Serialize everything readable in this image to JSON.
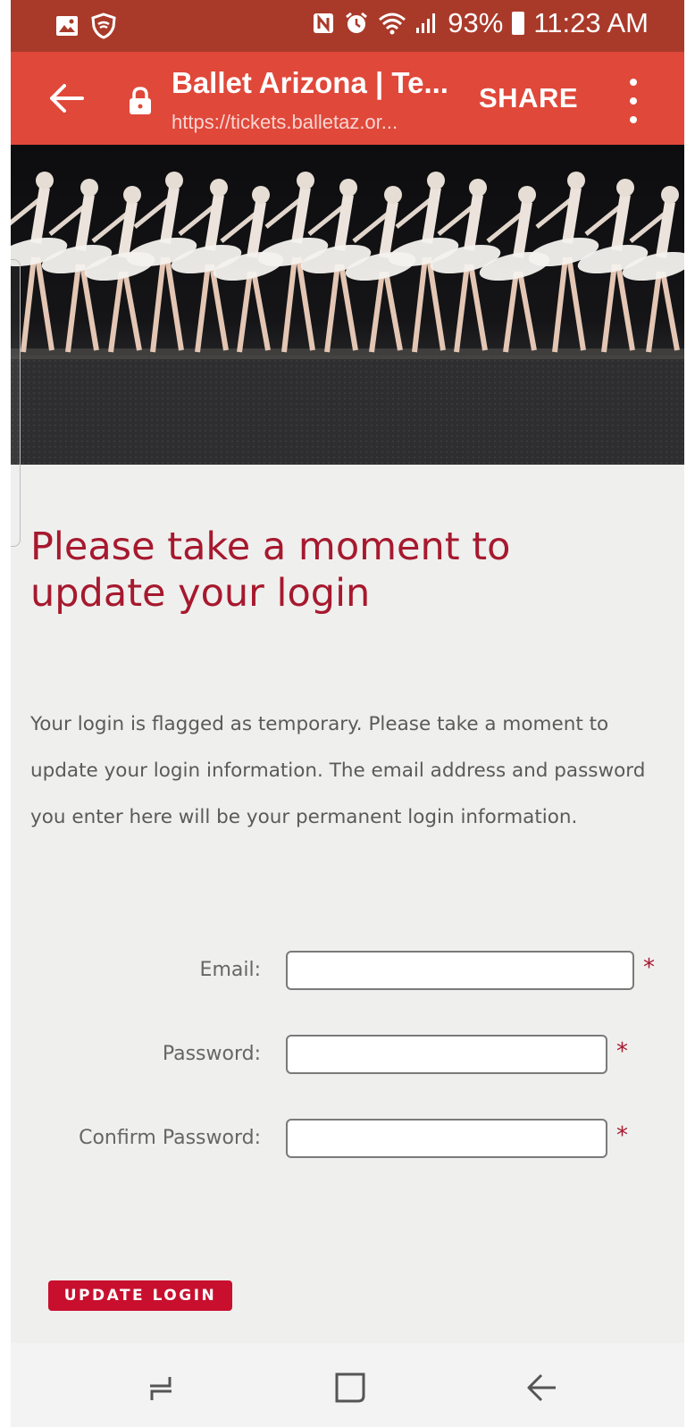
{
  "status_bar": {
    "battery": "93%",
    "time": "11:23 AM"
  },
  "toolbar": {
    "title": "Ballet Arizona | Te...",
    "url": "https://tickets.balletaz.or...",
    "share_label": "SHARE"
  },
  "page": {
    "heading": "Please take a moment to update your login",
    "paragraph": "Your login is flagged as temporary. Please take a moment to update your login information. The email address and password you enter here will be your permanent login information."
  },
  "form": {
    "email_label": "Email:",
    "email_value": "",
    "password_label": "Password:",
    "password_value": "",
    "confirm_label": "Confirm Password:",
    "confirm_value": "",
    "required_marker": "*",
    "submit_label": "UPDATE LOGIN"
  },
  "colors": {
    "toolbar": "#e0483a",
    "status_bar": "#a93a2a",
    "accent": "#a6192e",
    "button": "#c8102e"
  },
  "icons": {
    "status_left": [
      "gallery-icon",
      "vpn-shield-icon"
    ],
    "status_right": [
      "nfc-icon",
      "alarm-icon",
      "wifi-icon",
      "signal-icon",
      "battery-icon"
    ],
    "toolbar": [
      "back-arrow-icon",
      "lock-icon",
      "more-vert-icon"
    ],
    "nav": [
      "recents-icon",
      "home-icon",
      "back-icon"
    ]
  }
}
